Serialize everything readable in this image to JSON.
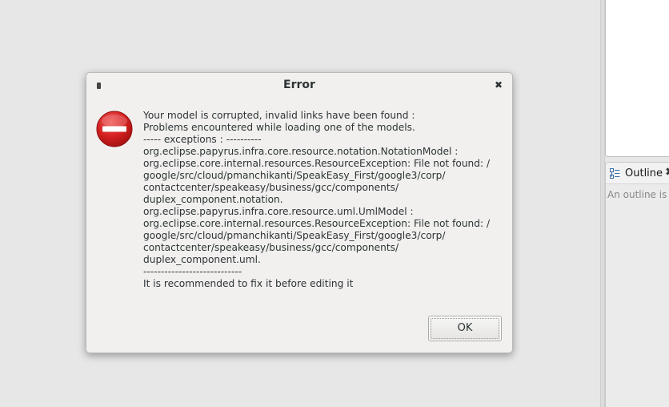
{
  "dialog": {
    "title": "Error",
    "icon": "error-stop-icon",
    "message_lines": [
      "Your model is corrupted, invalid links have been found :",
      "Problems encountered while loading one of the models.",
      "----- exceptions : ----------",
      "org.eclipse.papyrus.infra.core.resource.notation.NotationModel :",
      "org.eclipse.core.internal.resources.ResourceException: File not found: /",
      "google/src/cloud/pmanchikanti/SpeakEasy_First/google3/corp/",
      "contactcenter/speakeasy/business/gcc/components/",
      "duplex_component.notation.",
      "org.eclipse.papyrus.infra.core.resource.uml.UmlModel :",
      "org.eclipse.core.internal.resources.ResourceException: File not found: /",
      "google/src/cloud/pmanchikanti/SpeakEasy_First/google3/corp/",
      "contactcenter/speakeasy/business/gcc/components/",
      "duplex_component.uml.",
      "----------------------------",
      "It is recommended to fix it before editing it"
    ],
    "ok_label": "OK",
    "colors": {
      "error_red": "#cc1f1f",
      "background": "#f1f0ee"
    }
  },
  "outline": {
    "tab_label": "Outline",
    "empty_text": "An outline is",
    "close_glyph": "✖"
  }
}
